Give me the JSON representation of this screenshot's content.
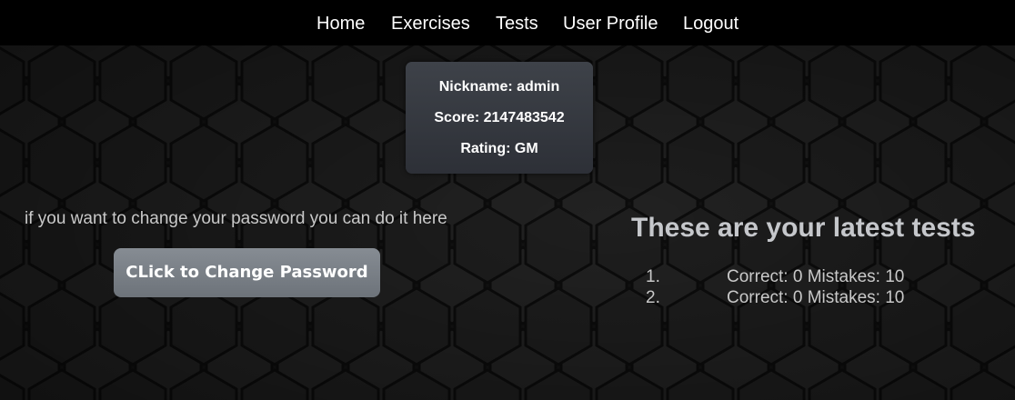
{
  "nav": {
    "items": [
      {
        "label": "Home"
      },
      {
        "label": "Exercises"
      },
      {
        "label": "Tests"
      },
      {
        "label": "User Profile"
      },
      {
        "label": "Logout"
      }
    ]
  },
  "profile": {
    "nickname": "Nickname: admin",
    "score": "Score: 2147483542",
    "rating": "Rating: GM"
  },
  "password": {
    "prompt": "if you want to change your password you can do it here",
    "button_label": "CLick to Change Password"
  },
  "tests": {
    "heading": "These are your latest tests",
    "items": [
      {
        "number": "1.",
        "text": "Correct: 0 Mistakes: 10"
      },
      {
        "number": "2.",
        "text": "Correct: 0 Mistakes: 10"
      }
    ]
  },
  "colors": {
    "navbar": "#000000",
    "background": "#1a1a1a",
    "card": "#3a3e45",
    "button": "#7a8087",
    "heading": "#c5c7cb"
  }
}
